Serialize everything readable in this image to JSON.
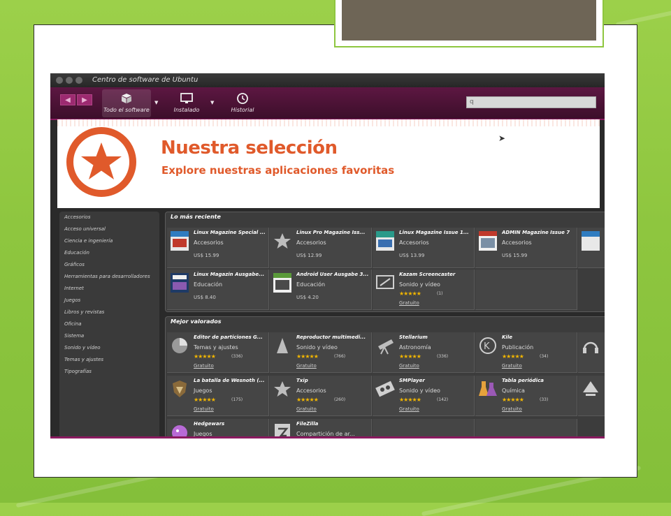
{
  "window": {
    "title": "Centro de software de Ubuntu"
  },
  "toolbar": {
    "back_label": "◀",
    "forward_label": "▶",
    "tools": [
      {
        "label": "Todo el software",
        "icon": "box-icon",
        "active": true
      },
      {
        "label": "Instalado",
        "icon": "monitor-icon",
        "active": false
      },
      {
        "label": "Historial",
        "icon": "clock-icon",
        "active": false
      }
    ],
    "search_value": "q"
  },
  "hero": {
    "title": "Nuestra selección",
    "subtitle": "Explore nuestras aplicaciones favoritas"
  },
  "sidebar": {
    "items": [
      "Accesorios",
      "Acceso universal",
      "Ciencia e ingeniería",
      "Educación",
      "Gráficos",
      "Herramientas para desarrolladores",
      "Internet",
      "Juegos",
      "Libros y revistas",
      "Oficina",
      "Sistema",
      "Sonido y vídeo",
      "Temas y ajustes",
      "Tipografías"
    ]
  },
  "recent": {
    "title": "Lo más reciente",
    "cards": [
      {
        "name": "Linux Magazine Special ...",
        "category": "Accesorios",
        "price": "US$ 15.99",
        "icon": "magazine-icon"
      },
      {
        "name": "Linux Pro Magazine Iss...",
        "category": "Accesorios",
        "price": "US$ 12.99",
        "icon": "star-icon"
      },
      {
        "name": "Linux Magazine Issue 1...",
        "category": "Accesorios",
        "price": "US$ 13.99",
        "icon": "magazine-icon"
      },
      {
        "name": "ADMIN Magazine Issue 7",
        "category": "Accesorios",
        "price": "US$ 15.99",
        "icon": "magazine-icon"
      },
      {
        "name": "Linux Magazin Ausgabe...",
        "category": "Educación",
        "price": "US$ 8.40",
        "icon": "magazine-icon"
      },
      {
        "name": "Android User Ausgabe 3...",
        "category": "Educación",
        "price": "US$ 4.20",
        "icon": "magazine-icon"
      },
      {
        "name": "Kazam Screencaster",
        "category": "Sonido y vídeo",
        "stars": "★★★★★",
        "count": "(1)",
        "free": "Gratuito",
        "icon": "screencast-icon"
      }
    ]
  },
  "top_rated": {
    "title": "Mejor valorados",
    "cards": [
      {
        "name": "Editor de particiones G...",
        "category": "Temas y ajustes",
        "stars": "★★★★★",
        "count": "(336)",
        "free": "Gratuito",
        "icon": "disk-icon"
      },
      {
        "name": "Reproductor multimedi...",
        "category": "Sonido y vídeo",
        "stars": "★★★★★",
        "count": "(766)",
        "free": "Gratuito",
        "icon": "vlc-cone-icon"
      },
      {
        "name": "Stellarium",
        "category": "Astronomía",
        "stars": "★★★★★",
        "count": "(336)",
        "free": "Gratuito",
        "icon": "telescope-icon"
      },
      {
        "name": "Kile",
        "category": "Publicación",
        "stars": "★★★★★",
        "count": "(34)",
        "free": "Gratuito",
        "icon": "kile-icon"
      },
      {
        "name": "La batalla de Wesnoth (...",
        "category": "Juegos",
        "stars": "★★★★★",
        "count": "(175)",
        "free": "Gratuito",
        "icon": "shield-icon"
      },
      {
        "name": "Txip",
        "category": "Accesorios",
        "stars": "★★★★★",
        "count": "(260)",
        "free": "Gratuito",
        "icon": "star-icon"
      },
      {
        "name": "SMPlayer",
        "category": "Sonido y vídeo",
        "stars": "★★★★★",
        "count": "(142)",
        "free": "Gratuito",
        "icon": "film-icon"
      },
      {
        "name": "Tabla periódica",
        "category": "Química",
        "stars": "★★★★★",
        "count": "(33)",
        "free": "Gratuito",
        "icon": "flask-icon"
      },
      {
        "name": "Hedgewars",
        "category": "Juegos",
        "icon": "hedgehog-icon"
      },
      {
        "name": "FileZilla",
        "category": "Compartición de ar...",
        "icon": "filezilla-icon"
      }
    ]
  },
  "colors": {
    "accent": "#e05a2b",
    "toolbar": "#4a1235",
    "slide_bg": "#8ec63f",
    "title_box": "#6e6556"
  }
}
